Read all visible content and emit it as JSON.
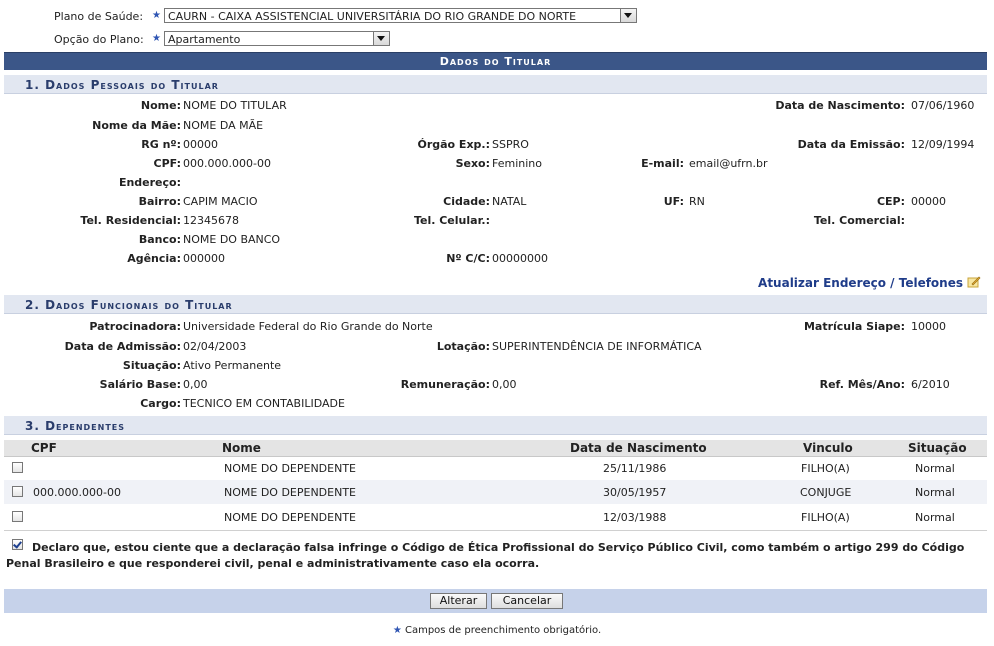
{
  "top": {
    "plano_label": "Plano de Saúde:",
    "plano_value": "CAURN - CAIXA ASSISTENCIAL UNIVERSITÁRIA DO RIO GRANDE DO NORTE",
    "opcao_label": "Opção do Plano:",
    "opcao_value": "Apartamento",
    "required_mark": "★"
  },
  "panel": {
    "caption": "Dados do Titular"
  },
  "s1": {
    "title": "1. Dados Pessoais do Titular",
    "nome_l": "Nome:",
    "nome_v": "NOME DO TITULAR",
    "nasc_l": "Data de Nascimento:",
    "nasc_v": "07/06/1960",
    "mae_l": "Nome da Mãe:",
    "mae_v": "NOME DA MÃE",
    "rg_l": "RG nº:",
    "rg_v": "00000",
    "orgao_l": "Órgão Exp.:",
    "orgao_v": "SSPRO",
    "emissao_l": "Data da Emissão:",
    "emissao_v": "12/09/1994",
    "cpf_l": "CPF:",
    "cpf_v": "000.000.000-00",
    "sexo_l": "Sexo:",
    "sexo_v": "Feminino",
    "email_l": "E-mail:",
    "email_v": "email@ufrn.br",
    "end_l": "Endereço:",
    "bairro_l": "Bairro:",
    "bairro_v": "CAPIM MACIO",
    "cidade_l": "Cidade:",
    "cidade_v": "NATAL",
    "uf_l": "UF:",
    "uf_v": "RN",
    "cep_l": "CEP:",
    "cep_v": "00000",
    "telres_l": "Tel. Residencial:",
    "telres_v": "12345678",
    "telcel_l": "Tel. Celular.:",
    "telcom_l": "Tel. Comercial:",
    "banco_l": "Banco:",
    "banco_v": "NOME DO BANCO",
    "agencia_l": "Agência:",
    "agencia_v": "000000",
    "cc_l": "Nº C/C:",
    "cc_v": "00000000",
    "update_link": "Atualizar Endereço / Telefones"
  },
  "s2": {
    "title": "2. Dados Funcionais do Titular",
    "patro_l": "Patrocinadora:",
    "patro_v": "Universidade Federal do Rio Grande do Norte",
    "siape_l": "Matrícula Siape:",
    "siape_v": "10000",
    "adm_l": "Data de Admissão:",
    "adm_v": "02/04/2003",
    "lot_l": "Lotação:",
    "lot_v": "SUPERINTENDÊNCIA DE INFORMÁTICA",
    "sit_l": "Situação:",
    "sit_v": "Ativo Permanente",
    "sal_l": "Salário Base:",
    "sal_v": "0,00",
    "rem_l": "Remuneração:",
    "rem_v": "0,00",
    "ref_l": "Ref. Mês/Ano:",
    "ref_v": "6/2010",
    "cargo_l": "Cargo:",
    "cargo_v": "TECNICO EM CONTABILIDADE"
  },
  "s3": {
    "title": "3. Dependentes",
    "headers": {
      "cpf": "CPF",
      "nome": "Nome",
      "nasc": "Data de Nascimento",
      "vinculo": "Vinculo",
      "situacao": "Situação"
    },
    "rows": [
      {
        "cpf": "",
        "nome": "NOME DO DEPENDENTE",
        "nasc": "25/11/1986",
        "vinculo": "FILHO(A)",
        "situacao": "Normal"
      },
      {
        "cpf": "000.000.000-00",
        "nome": "NOME DO DEPENDENTE",
        "nasc": "30/05/1957",
        "vinculo": "CONJUGE",
        "situacao": "Normal"
      },
      {
        "cpf": "",
        "nome": "NOME DO DEPENDENTE",
        "nasc": "12/03/1988",
        "vinculo": "FILHO(A)",
        "situacao": "Normal"
      }
    ]
  },
  "declaration": "Declaro que, estou ciente que a declaração falsa infringe o Código de Ética Profissional do Serviço Público Civil, como também o artigo 299 do Código Penal Brasileiro e que responderei civil, penal e administrativamente caso ela ocorra.",
  "buttons": {
    "alterar": "Alterar",
    "cancelar": "Cancelar"
  },
  "footnote": "Campos de preenchimento obrigatório.",
  "colors": {
    "caption_bg": "#3b5688",
    "section_bg": "#e2e7f1",
    "footer_bg": "#c6d2ea",
    "link": "#1f3c89"
  }
}
